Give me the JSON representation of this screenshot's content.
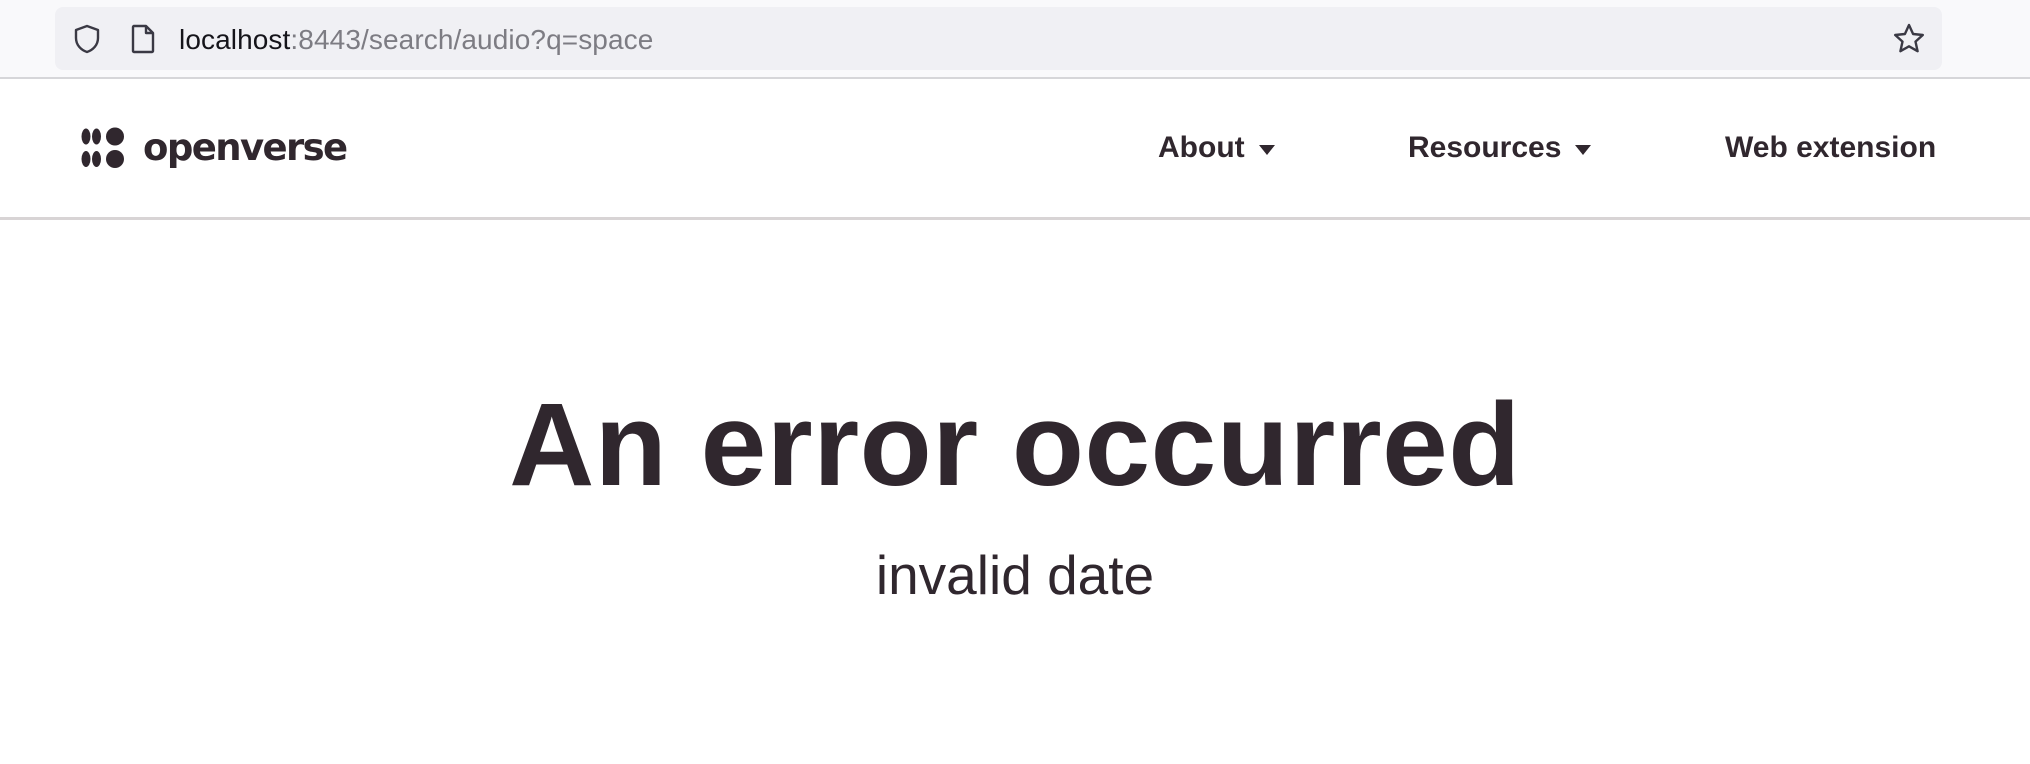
{
  "browser": {
    "url_host": "localhost",
    "url_path": ":8443/search/audio?q=space",
    "icons": {
      "tracking_protection": "shield-icon",
      "page_info": "page-icon",
      "bookmark": "star-icon"
    }
  },
  "header": {
    "logo_text": "openverse",
    "nav": {
      "about_label": "About",
      "resources_label": "Resources",
      "extension_label": "Web extension"
    }
  },
  "error": {
    "title": "An error occurred",
    "message": "invalid date"
  },
  "colors": {
    "text": "#30272e",
    "divider": "#d8d4d5",
    "url_bar_bg": "#f0f0f4"
  }
}
